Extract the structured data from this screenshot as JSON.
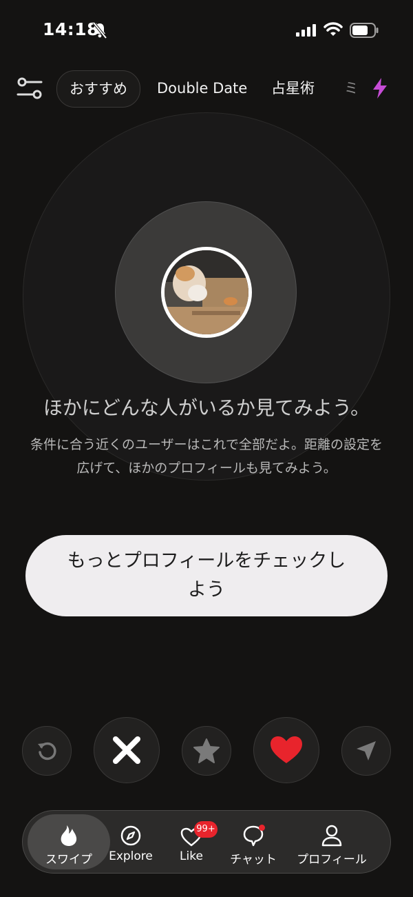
{
  "status_bar": {
    "time": "14:18",
    "icons": [
      "bell-muted-icon",
      "signal-icon",
      "wifi-icon",
      "battery-icon"
    ]
  },
  "top_nav": {
    "filter_icon": "sliders-icon",
    "tabs": [
      {
        "label": "おすすめ",
        "active": true
      },
      {
        "label": "Double Date",
        "active": false
      },
      {
        "label": "占星術",
        "active": false
      },
      {
        "label": "ミ",
        "active": false
      }
    ],
    "boost_icon": "lightning-icon",
    "accent_color": "#c64cd6"
  },
  "main": {
    "avatar_icon": "profile-photo",
    "headline": "ほかにどんな人がいるか見てみよう。",
    "subtext": "条件に合う近くのユーザーはこれで全部だよ。距離の設定を広げて、ほかのプロフィールも見てみよう。",
    "cta_label": "もっとプロフィールをチェックしよう"
  },
  "actions": {
    "icons": [
      "rewind-icon",
      "nope-x-icon",
      "super-like-star-icon",
      "like-heart-icon",
      "boost-send-icon"
    ],
    "like_color": "#e8242c"
  },
  "bottom_nav": {
    "items": [
      {
        "label": "スワイプ",
        "icon": "flame-icon",
        "active": true
      },
      {
        "label": "Explore",
        "icon": "compass-icon",
        "active": false
      },
      {
        "label": "Like",
        "icon": "heart-icon",
        "active": false
      },
      {
        "label": "チャット",
        "icon": "chat-icon",
        "active": false
      },
      {
        "label": "プロフィール",
        "icon": "person-icon",
        "active": false
      }
    ],
    "like_badge": "99+",
    "badge_color": "#e8242c"
  }
}
